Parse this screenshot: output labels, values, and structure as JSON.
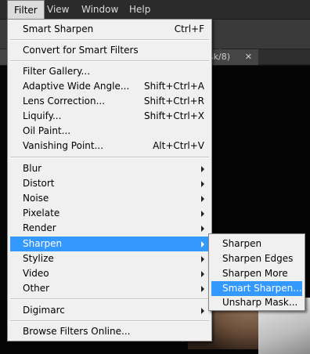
{
  "menubar": {
    "items": [
      {
        "label": "Filter",
        "active": true
      },
      {
        "label": "View"
      },
      {
        "label": "Window"
      },
      {
        "label": "Help"
      }
    ]
  },
  "document": {
    "tab_title_fragment": "sk/8)",
    "close_glyph": "✕"
  },
  "filter_menu": {
    "last_filter": {
      "label": "Smart Sharpen",
      "shortcut": "Ctrl+F"
    },
    "convert": {
      "label": "Convert for Smart Filters"
    },
    "special": [
      {
        "label": "Filter Gallery...",
        "shortcut": ""
      },
      {
        "label": "Adaptive Wide Angle...",
        "shortcut": "Shift+Ctrl+A"
      },
      {
        "label": "Lens Correction...",
        "shortcut": "Shift+Ctrl+R"
      },
      {
        "label": "Liquify...",
        "shortcut": "Shift+Ctrl+X"
      },
      {
        "label": "Oil Paint...",
        "shortcut": ""
      },
      {
        "label": "Vanishing Point...",
        "shortcut": "Alt+Ctrl+V"
      }
    ],
    "groups": [
      {
        "label": "Blur"
      },
      {
        "label": "Distort"
      },
      {
        "label": "Noise"
      },
      {
        "label": "Pixelate"
      },
      {
        "label": "Render"
      },
      {
        "label": "Sharpen",
        "highlighted": true
      },
      {
        "label": "Stylize"
      },
      {
        "label": "Video"
      },
      {
        "label": "Other"
      }
    ],
    "plugins": [
      {
        "label": "Digimarc"
      }
    ],
    "browse": {
      "label": "Browse Filters Online..."
    }
  },
  "sharpen_submenu": {
    "items": [
      {
        "label": "Sharpen"
      },
      {
        "label": "Sharpen Edges"
      },
      {
        "label": "Sharpen More"
      },
      {
        "label": "Smart Sharpen...",
        "highlighted": true
      },
      {
        "label": "Unsharp Mask..."
      }
    ]
  },
  "colors": {
    "highlight": "#3399ff",
    "menu_bg": "#f0f0f0",
    "app_bar": "#2b2b2b"
  }
}
